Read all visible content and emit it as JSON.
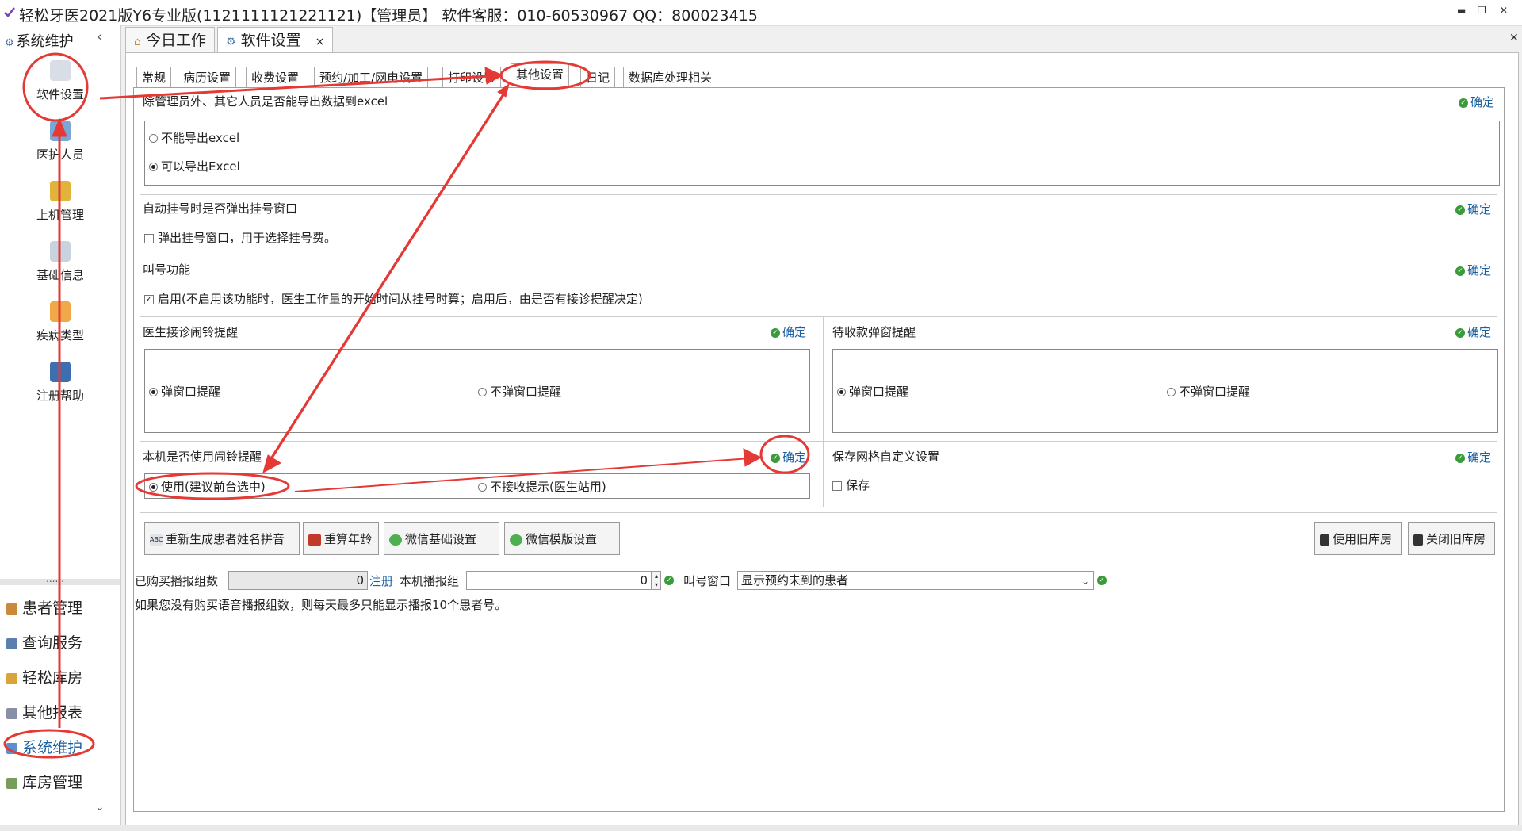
{
  "window": {
    "title": "轻松牙医2021版Y6专业版(1121111121221121)【管理员】    软件客服：010-60530967 QQ：800023415",
    "min": "▬",
    "max": "❐",
    "close": "✕"
  },
  "sidebar": {
    "header": "系统维护",
    "collapse": "‹",
    "items": [
      {
        "label": "软件设置",
        "icon": "gears-icon"
      },
      {
        "label": "医护人员",
        "icon": "users-icon"
      },
      {
        "label": "上机管理",
        "icon": "lock-icon"
      },
      {
        "label": "基础信息",
        "icon": "settings-doc-icon"
      },
      {
        "label": "疾病类型",
        "icon": "grid-icon"
      },
      {
        "label": "注册帮助",
        "icon": "help-icon"
      }
    ],
    "dots": "......",
    "nav": [
      {
        "label": "患者管理",
        "icon": "patients-icon"
      },
      {
        "label": "查询服务",
        "icon": "search-icon"
      },
      {
        "label": "轻松库房",
        "icon": "box-icon"
      },
      {
        "label": "其他报表",
        "icon": "report-icon"
      },
      {
        "label": "系统维护",
        "icon": "gear-icon"
      },
      {
        "label": "库房管理",
        "icon": "warehouse-icon"
      }
    ],
    "down": "⌄"
  },
  "tabs": [
    {
      "label": "今日工作",
      "icon": "home-icon"
    },
    {
      "label": "软件设置",
      "icon": "gear-icon",
      "close": "×"
    }
  ],
  "close_all": "✕",
  "subtabs": [
    "常规",
    "病历设置",
    "收费设置",
    "预约/加工/网电设置",
    "打印设置",
    "其他设置",
    "日记",
    "数据库处理相关"
  ],
  "confirm": "确定",
  "sections": {
    "export": {
      "title": "除管理员外、其它人员是否能导出数据到excel",
      "options": [
        "不能导出excel",
        "可以导出Excel"
      ]
    },
    "auto_popup": {
      "title": "自动挂号时是否弹出挂号窗口",
      "option": "弹出挂号窗口，用于选择挂号费。"
    },
    "call": {
      "title": "叫号功能",
      "option": "启用(不启用该功能时，医生工作量的开始时间从挂号时算；启用后，由是否有接诊提醒决定)"
    },
    "doctor_bell": {
      "title": "医生接诊闹铃提醒",
      "options": [
        "弹窗口提醒",
        "不弹窗口提醒"
      ]
    },
    "pending_payment": {
      "title": "待收款弹窗提醒",
      "options": [
        "弹窗口提醒",
        "不弹窗口提醒"
      ]
    },
    "local_bell": {
      "title": "本机是否使用闹铃提醒",
      "options": [
        "使用(建议前台选中)",
        "不接收提示(医生站用)"
      ]
    },
    "grid": {
      "title": "保存网格自定义设置",
      "option": "保存"
    }
  },
  "buttons": {
    "regen_pinyin": "重新生成患者姓名拼音",
    "recalc_age": "重算年龄",
    "wechat_basic": "微信基础设置",
    "wechat_template": "微信模版设置",
    "use_old_store": "使用旧库房",
    "close_old_store": "关闭旧库房"
  },
  "broadcast": {
    "purchased_label": "已购买播报组数",
    "purchased_value": "0",
    "register": "注册",
    "local_label": "本机播报组",
    "local_value": "0",
    "window_label": "叫号窗口",
    "window_value": "显示预约未到的患者",
    "note": "如果您没有购买语音播报组数，则每天最多只能显示播报10个患者号。"
  },
  "colors": {
    "annotation": "#e53935",
    "link": "#1a5fa0",
    "check": "#3a9b3a"
  }
}
